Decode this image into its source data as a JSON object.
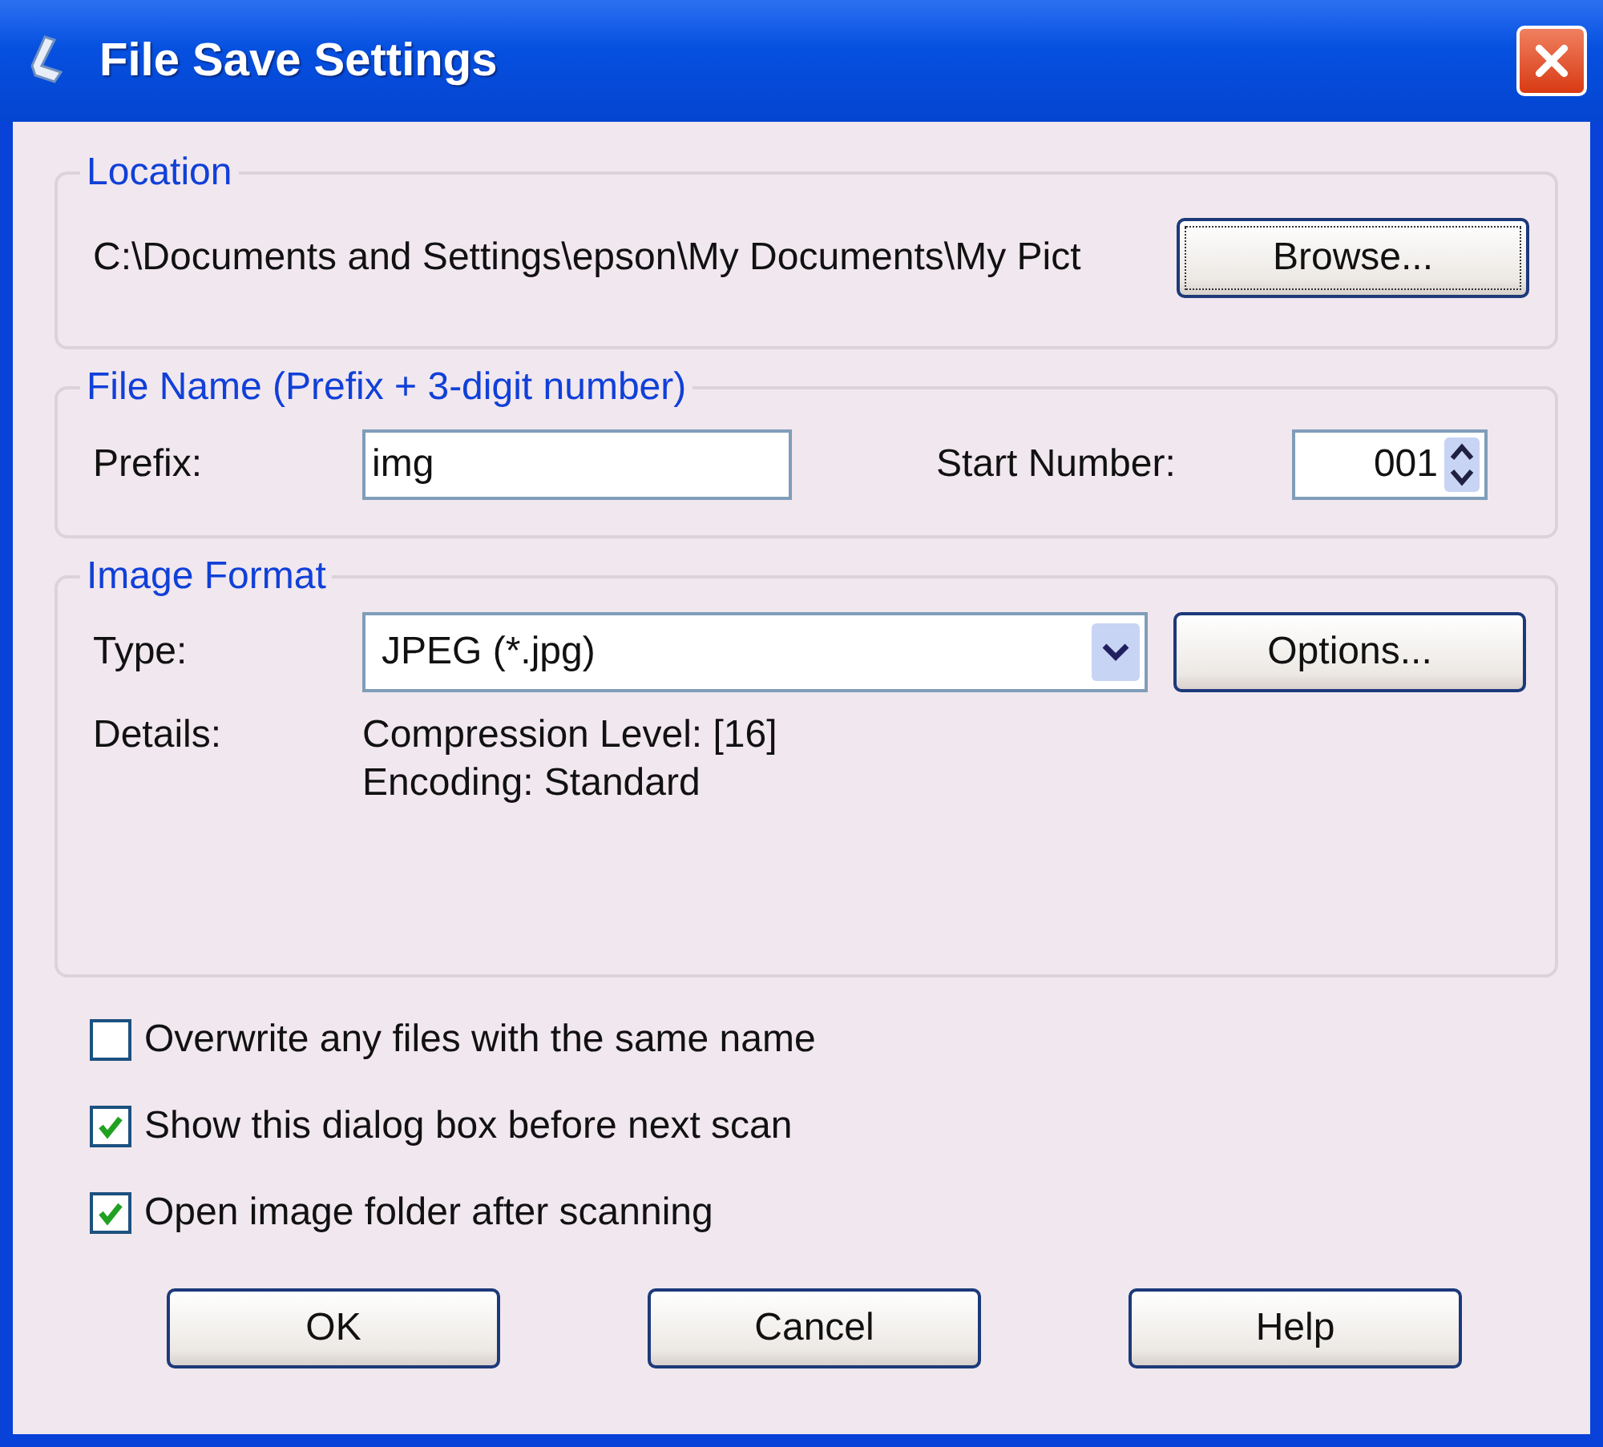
{
  "window": {
    "title": "File Save Settings"
  },
  "location": {
    "legend": "Location",
    "path": "C:\\Documents and Settings\\epson\\My Documents\\My Pict",
    "browse_button": "Browse..."
  },
  "file_name": {
    "legend": "File Name (Prefix + 3-digit number)",
    "prefix_label": "Prefix:",
    "prefix_value": "img",
    "start_label": "Start Number:",
    "start_value": "001"
  },
  "image_format": {
    "legend": "Image Format",
    "type_label": "Type:",
    "type_value": "JPEG (*.jpg)",
    "options_button": "Options...",
    "details_label": "Details:",
    "details": [
      "Compression Level: [16]",
      "Encoding: Standard"
    ]
  },
  "options": [
    {
      "label": "Overwrite any files with the same name",
      "checked": false
    },
    {
      "label": "Show this dialog box before next scan",
      "checked": true
    },
    {
      "label": "Open image folder after scanning",
      "checked": true
    }
  ],
  "buttons": [
    "OK",
    "Cancel",
    "Help"
  ]
}
